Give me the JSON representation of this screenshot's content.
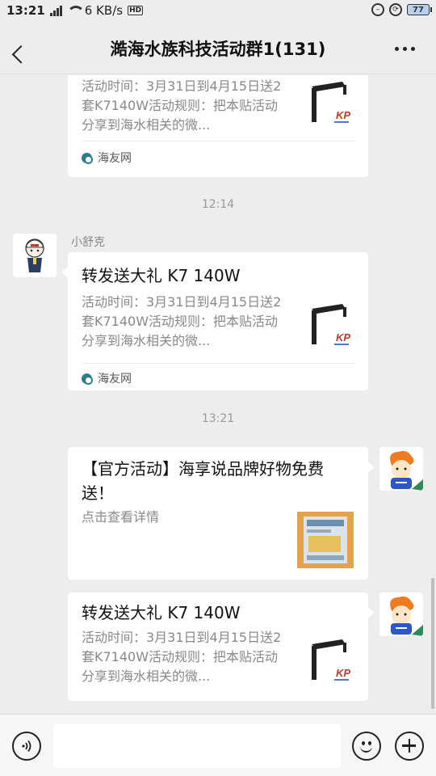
{
  "status_bar": {
    "time": "13:21",
    "speed": "6 KB/s",
    "hd": "HD",
    "battery": "77"
  },
  "header": {
    "title": "澔海水族科技活动群1(131)"
  },
  "messages": [
    {
      "desc": "活动时间：3月31日到4月15日送2套K7140W活动规则：把本贴活动分享到海水相关的微...",
      "source": "海友网"
    },
    {
      "timestamp": "12:14",
      "sender": "小舒克",
      "title": "转发送大礼 K7 140W",
      "desc": "活动时间：3月31日到4月15日送2套K7140W活动规则：把本贴活动分享到海水相关的微...",
      "source": "海友网"
    },
    {
      "timestamp": "13:21",
      "title": "【官方活动】海享说品牌好物免费送！",
      "desc": "点击查看详情"
    },
    {
      "title": "转发送大礼 K7 140W",
      "desc": "活动时间：3月31日到4月15日送2套K7140W活动规则：把本贴活动分享到海水相关的微..."
    }
  ]
}
